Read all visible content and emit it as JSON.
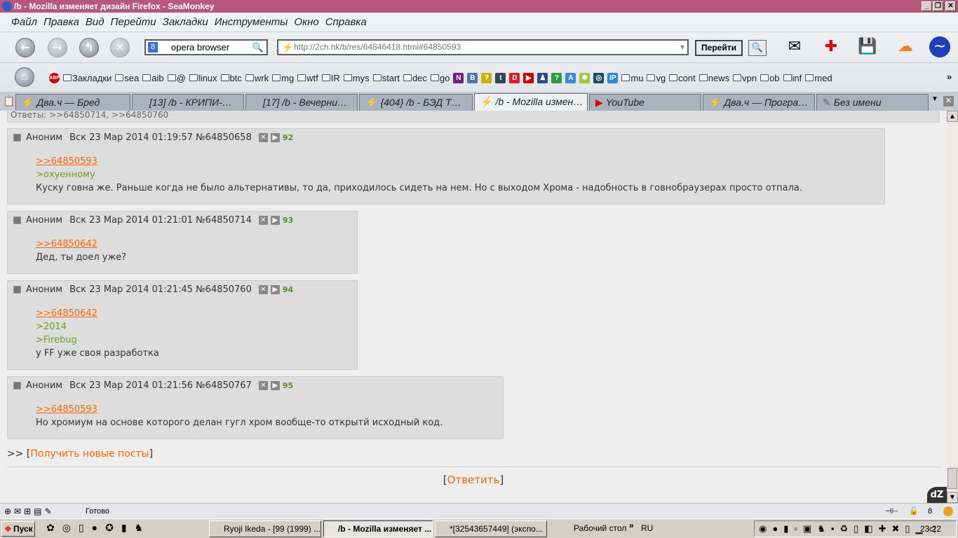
{
  "window": {
    "title": "/b - Mozilla изменяет дизайн Firefox - SeaMonkey"
  },
  "menu": [
    "Файл",
    "Правка",
    "Вид",
    "Перейти",
    "Закладки",
    "Инструменты",
    "Окно",
    "Справка"
  ],
  "navbar": {
    "search_value": "opera browser",
    "search_engine": "8",
    "url": "http://2ch.hk/b/res/64846418.html#64850593",
    "go_label": "Перейти"
  },
  "bookmarks": {
    "folders_a": [
      "Закладки",
      "sea",
      "aib",
      "@",
      "linux",
      "btc",
      "wrk",
      "mg",
      "wtf",
      "IR",
      "mys",
      "start",
      "dec",
      "go"
    ],
    "icons": [
      {
        "t": "N",
        "c": "#7a1a8a"
      },
      {
        "t": "B",
        "c": "#4a76a8"
      },
      {
        "t": "?",
        "c": "#c8b400"
      },
      {
        "t": "t",
        "c": "#35465c"
      },
      {
        "t": "D",
        "c": "#e01c24"
      },
      {
        "t": "▶",
        "c": "#cc0000"
      },
      {
        "t": "♟",
        "c": "#2a4a8a"
      },
      {
        "t": "?",
        "c": "#2a9a3a"
      },
      {
        "t": "A",
        "c": "#3a8ad8"
      },
      {
        "t": "✱",
        "c": "#a4c639"
      },
      {
        "t": "◎",
        "c": "#1a4a6a"
      },
      {
        "t": "IP",
        "c": "#2a8ad8"
      }
    ],
    "folders_b": [
      "mu",
      "vg",
      "cont",
      "news",
      "vpn",
      "ob",
      "inf",
      "med"
    ],
    "more": "»"
  },
  "tabs": [
    {
      "label": "Два.ч — Бред",
      "icon": "bolt"
    },
    {
      "label": "[13] /b - КРИПИ-…",
      "icon": ""
    },
    {
      "label": "[17] /b - Вечерни…",
      "icon": ""
    },
    {
      "label": "{404} /b - БЭД Т…",
      "icon": "bolt"
    },
    {
      "label": "/b - Mozilla измен…",
      "icon": "bolt",
      "active": true
    },
    {
      "label": "YouTube",
      "icon": "youtube"
    },
    {
      "label": "Два.ч — Програ…",
      "icon": "bolt"
    },
    {
      "label": "Без имени",
      "icon": "pencil"
    }
  ],
  "thread": {
    "top_replies": "Ответы: >>64850714, >>64850760",
    "posts": [
      {
        "name": "Аноним",
        "date": "Вск 23 Мар 2014 01:19:57",
        "id": "№64850658",
        "num": "92",
        "ref": ">>64850593",
        "quotes": [
          ">охуенному"
        ],
        "text": "Куску говна же. Раньше когда не было альтернативы, то да, приходилось сидеть на нем. Но с выходом Хрома - надобность в говнобраузерах просто отпала."
      },
      {
        "name": "Аноним",
        "date": "Вск 23 Мар 2014 01:21:01",
        "id": "№64850714",
        "num": "93",
        "ref": ">>64850642",
        "quotes": [],
        "text": "Дед, ты доел уже?"
      },
      {
        "name": "Аноним",
        "date": "Вск 23 Мар 2014 01:21:45",
        "id": "№64850760",
        "num": "94",
        "ref": ">>64850642",
        "quotes": [
          ">2014",
          ">Firebug"
        ],
        "text": "у FF уже своя разработка"
      },
      {
        "name": "Аноним",
        "date": "Вск 23 Мар 2014 01:21:56",
        "id": "№64850767",
        "num": "95",
        "ref": ">>64850593",
        "quotes": [],
        "text": "Но хромиум на основе которого делан гугл хром вообще-то открытй исходный код."
      }
    ],
    "get_new_prefix": ">> [",
    "get_new": "Получить новые посты",
    "get_new_suffix": "]",
    "reply_open": "[",
    "reply": "Ответить",
    "reply_close": "]"
  },
  "status": {
    "text": "Готово",
    "counter": "8"
  },
  "taskbar": {
    "start": "Пуск",
    "tasks": [
      "Ryoji Ikeda - [99 (1999) ...",
      "/b - Mozilla изменяет ...",
      "*[32543657449] (экспо..."
    ],
    "desktop": "Рабочий стол",
    "lang": "RU",
    "clock": "23:22"
  }
}
